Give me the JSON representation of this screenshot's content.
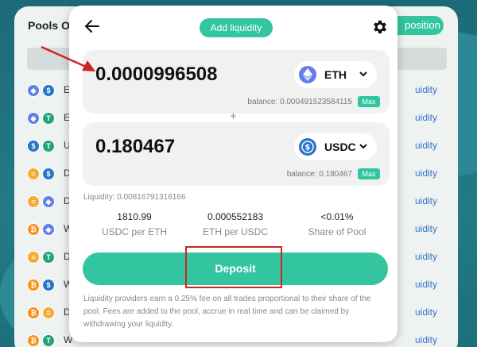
{
  "background": {
    "title": "Pools O",
    "position_button": "position",
    "rows": [
      {
        "a": "eth",
        "b": "usdc",
        "letter": "E",
        "liq": "uidity"
      },
      {
        "a": "eth",
        "b": "usdt",
        "letter": "E",
        "liq": "uidity"
      },
      {
        "a": "usdc",
        "b": "usdt",
        "letter": "U",
        "liq": "uidity"
      },
      {
        "a": "dai",
        "b": "usdc",
        "letter": "D",
        "liq": "uidity"
      },
      {
        "a": "dai",
        "b": "eth",
        "letter": "D",
        "liq": "uidity"
      },
      {
        "a": "btc",
        "b": "eth",
        "letter": "W",
        "liq": "uidity"
      },
      {
        "a": "dai",
        "b": "usdt",
        "letter": "D",
        "liq": "uidity"
      },
      {
        "a": "btc",
        "b": "usdc",
        "letter": "W",
        "liq": "uidity"
      },
      {
        "a": "btc",
        "b": "dai",
        "letter": "D",
        "liq": "uidity"
      },
      {
        "a": "btc",
        "b": "usdt",
        "letter": "W",
        "liq": "uidity"
      }
    ]
  },
  "modal": {
    "title": "Add liquidity",
    "token_a": {
      "amount": "0.0000996508",
      "symbol": "ETH",
      "icon": "eth-icon",
      "balance": "balance: 0.000491523584115",
      "max_label": "Max"
    },
    "plus": "+",
    "token_b": {
      "amount": "0.180467",
      "symbol": "USDC",
      "icon": "usdc-icon",
      "balance": "balance: 0.180467",
      "max_label": "Max"
    },
    "liquidity": "Liquidity: 0.00816791316166",
    "stats": [
      {
        "value": "1810.99",
        "label": "USDC per ETH"
      },
      {
        "value": "0.000552183",
        "label": "ETH per USDC"
      },
      {
        "value": "<0.01%",
        "label": "Share of Pool"
      }
    ],
    "deposit_label": "Deposit",
    "note": "Liquidity providers earn a 0.25% fee on all trades proportional to their share of the pool. Fees are added to the pool, accrue in real time and can be claimed by withdrawing your liquidity."
  },
  "colors": {
    "accent": "#33c5a0",
    "annotation": "#d0241f"
  }
}
